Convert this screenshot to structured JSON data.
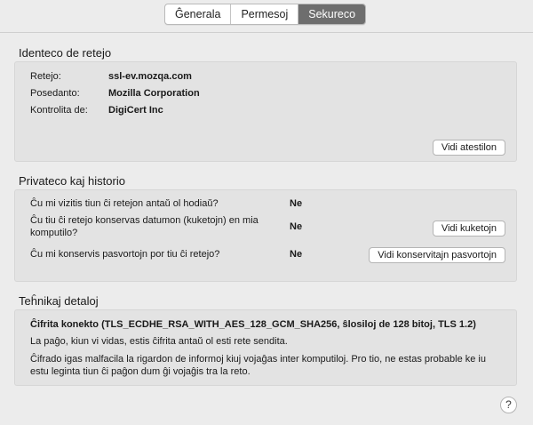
{
  "tabs": [
    {
      "label": "Ĝenerala",
      "active": false
    },
    {
      "label": "Permesoj",
      "active": false
    },
    {
      "label": "Sekureco",
      "active": true
    }
  ],
  "identity": {
    "heading": "Identeco de retejo",
    "rows": [
      {
        "label": "Retejo:",
        "value": "ssl-ev.mozqa.com"
      },
      {
        "label": "Posedanto:",
        "value": "Mozilla Corporation"
      },
      {
        "label": "Kontrolita de:",
        "value": "DigiCert Inc"
      }
    ],
    "view_cert_button": "Vidi atestilon"
  },
  "privacy": {
    "heading": "Privateco kaj historio",
    "rows": [
      {
        "question": "Ĉu mi vizitis tiun ĉi retejon antaŭ ol hodiaŭ?",
        "answer": "Ne"
      },
      {
        "question": "Ĉu tiu ĉi retejo konservas datumon (kuketojn) en mia komputilo?",
        "answer": "Ne",
        "button": "Vidi kuketojn"
      },
      {
        "question": "Ĉu mi konservis pasvortojn por tiu ĉi retejo?",
        "answer": "Ne",
        "button": "Vidi konservitajn pasvortojn"
      }
    ]
  },
  "technical": {
    "heading": "Teĥnikaj detaloj",
    "cipher_title": "Ĉifrita konekto (TLS_ECDHE_RSA_WITH_AES_128_GCM_SHA256, ŝlosiloj de 128 bitoj, TLS 1.2)",
    "line1": "La paĝo, kiun vi vidas, estis ĉifrita antaŭ ol esti rete sendita.",
    "line2": "Ĉifrado igas malfacila la rigardon de informoj kiuj vojaĝas inter komputiloj. Pro tio, ne estas probable ke iu estu leginta tiun ĉi paĝon dum ĝi vojaĝis tra la reto."
  },
  "help": {
    "glyph": "?"
  }
}
